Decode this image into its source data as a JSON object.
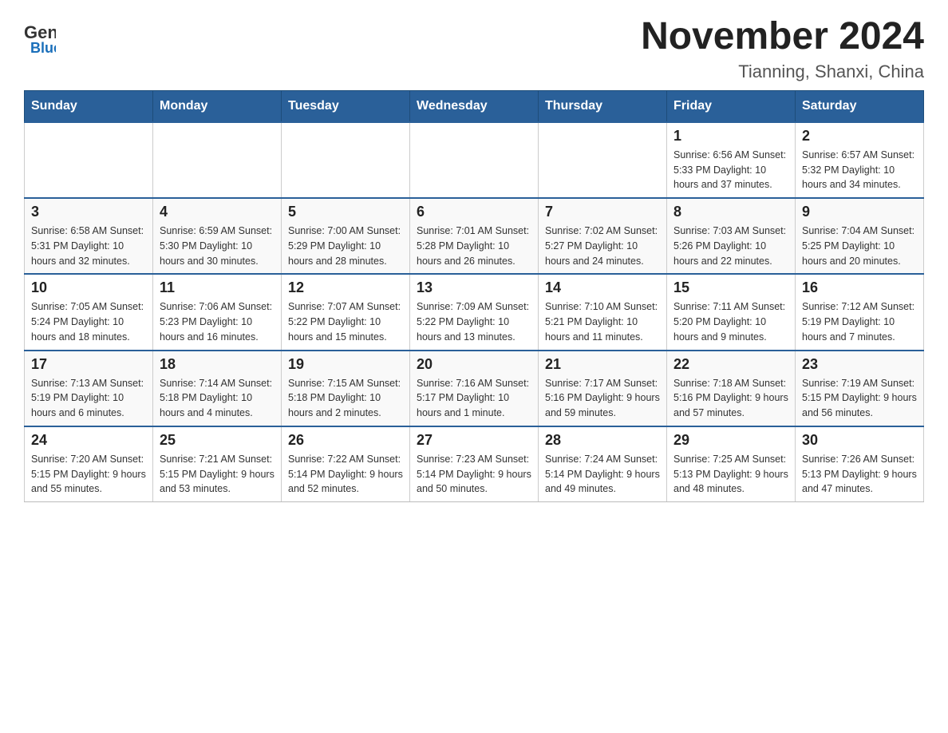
{
  "header": {
    "logo_text_general": "General",
    "logo_text_blue": "Blue",
    "title": "November 2024",
    "subtitle": "Tianning, Shanxi, China"
  },
  "days_of_week": [
    "Sunday",
    "Monday",
    "Tuesday",
    "Wednesday",
    "Thursday",
    "Friday",
    "Saturday"
  ],
  "weeks": [
    [
      {
        "day": "",
        "info": ""
      },
      {
        "day": "",
        "info": ""
      },
      {
        "day": "",
        "info": ""
      },
      {
        "day": "",
        "info": ""
      },
      {
        "day": "",
        "info": ""
      },
      {
        "day": "1",
        "info": "Sunrise: 6:56 AM\nSunset: 5:33 PM\nDaylight: 10 hours and 37 minutes."
      },
      {
        "day": "2",
        "info": "Sunrise: 6:57 AM\nSunset: 5:32 PM\nDaylight: 10 hours and 34 minutes."
      }
    ],
    [
      {
        "day": "3",
        "info": "Sunrise: 6:58 AM\nSunset: 5:31 PM\nDaylight: 10 hours and 32 minutes."
      },
      {
        "day": "4",
        "info": "Sunrise: 6:59 AM\nSunset: 5:30 PM\nDaylight: 10 hours and 30 minutes."
      },
      {
        "day": "5",
        "info": "Sunrise: 7:00 AM\nSunset: 5:29 PM\nDaylight: 10 hours and 28 minutes."
      },
      {
        "day": "6",
        "info": "Sunrise: 7:01 AM\nSunset: 5:28 PM\nDaylight: 10 hours and 26 minutes."
      },
      {
        "day": "7",
        "info": "Sunrise: 7:02 AM\nSunset: 5:27 PM\nDaylight: 10 hours and 24 minutes."
      },
      {
        "day": "8",
        "info": "Sunrise: 7:03 AM\nSunset: 5:26 PM\nDaylight: 10 hours and 22 minutes."
      },
      {
        "day": "9",
        "info": "Sunrise: 7:04 AM\nSunset: 5:25 PM\nDaylight: 10 hours and 20 minutes."
      }
    ],
    [
      {
        "day": "10",
        "info": "Sunrise: 7:05 AM\nSunset: 5:24 PM\nDaylight: 10 hours and 18 minutes."
      },
      {
        "day": "11",
        "info": "Sunrise: 7:06 AM\nSunset: 5:23 PM\nDaylight: 10 hours and 16 minutes."
      },
      {
        "day": "12",
        "info": "Sunrise: 7:07 AM\nSunset: 5:22 PM\nDaylight: 10 hours and 15 minutes."
      },
      {
        "day": "13",
        "info": "Sunrise: 7:09 AM\nSunset: 5:22 PM\nDaylight: 10 hours and 13 minutes."
      },
      {
        "day": "14",
        "info": "Sunrise: 7:10 AM\nSunset: 5:21 PM\nDaylight: 10 hours and 11 minutes."
      },
      {
        "day": "15",
        "info": "Sunrise: 7:11 AM\nSunset: 5:20 PM\nDaylight: 10 hours and 9 minutes."
      },
      {
        "day": "16",
        "info": "Sunrise: 7:12 AM\nSunset: 5:19 PM\nDaylight: 10 hours and 7 minutes."
      }
    ],
    [
      {
        "day": "17",
        "info": "Sunrise: 7:13 AM\nSunset: 5:19 PM\nDaylight: 10 hours and 6 minutes."
      },
      {
        "day": "18",
        "info": "Sunrise: 7:14 AM\nSunset: 5:18 PM\nDaylight: 10 hours and 4 minutes."
      },
      {
        "day": "19",
        "info": "Sunrise: 7:15 AM\nSunset: 5:18 PM\nDaylight: 10 hours and 2 minutes."
      },
      {
        "day": "20",
        "info": "Sunrise: 7:16 AM\nSunset: 5:17 PM\nDaylight: 10 hours and 1 minute."
      },
      {
        "day": "21",
        "info": "Sunrise: 7:17 AM\nSunset: 5:16 PM\nDaylight: 9 hours and 59 minutes."
      },
      {
        "day": "22",
        "info": "Sunrise: 7:18 AM\nSunset: 5:16 PM\nDaylight: 9 hours and 57 minutes."
      },
      {
        "day": "23",
        "info": "Sunrise: 7:19 AM\nSunset: 5:15 PM\nDaylight: 9 hours and 56 minutes."
      }
    ],
    [
      {
        "day": "24",
        "info": "Sunrise: 7:20 AM\nSunset: 5:15 PM\nDaylight: 9 hours and 55 minutes."
      },
      {
        "day": "25",
        "info": "Sunrise: 7:21 AM\nSunset: 5:15 PM\nDaylight: 9 hours and 53 minutes."
      },
      {
        "day": "26",
        "info": "Sunrise: 7:22 AM\nSunset: 5:14 PM\nDaylight: 9 hours and 52 minutes."
      },
      {
        "day": "27",
        "info": "Sunrise: 7:23 AM\nSunset: 5:14 PM\nDaylight: 9 hours and 50 minutes."
      },
      {
        "day": "28",
        "info": "Sunrise: 7:24 AM\nSunset: 5:14 PM\nDaylight: 9 hours and 49 minutes."
      },
      {
        "day": "29",
        "info": "Sunrise: 7:25 AM\nSunset: 5:13 PM\nDaylight: 9 hours and 48 minutes."
      },
      {
        "day": "30",
        "info": "Sunrise: 7:26 AM\nSunset: 5:13 PM\nDaylight: 9 hours and 47 minutes."
      }
    ]
  ]
}
